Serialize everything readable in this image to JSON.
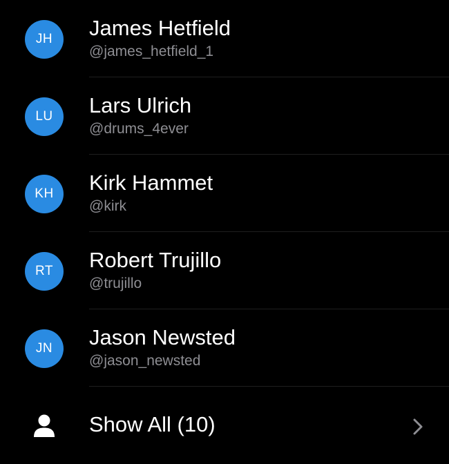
{
  "contacts": [
    {
      "initials": "JH",
      "name": "James Hetfield",
      "handle": "@james_hetfield_1"
    },
    {
      "initials": "LU",
      "name": "Lars Ulrich",
      "handle": "@drums_4ever"
    },
    {
      "initials": "KH",
      "name": "Kirk Hammet",
      "handle": "@kirk"
    },
    {
      "initials": "RT",
      "name": "Robert Trujillo",
      "handle": "@trujillo"
    },
    {
      "initials": "JN",
      "name": "Jason Newsted",
      "handle": "@jason_newsted"
    }
  ],
  "show_all": {
    "label": "Show All (10)",
    "icon": "person-icon",
    "chevron_icon": "chevron-right-icon"
  },
  "colors": {
    "background": "#000000",
    "avatar": "#2a8be2",
    "name_text": "#ffffff",
    "handle_text": "#8e8e93",
    "divider": "#1f1f1f",
    "chevron": "#8e8e93"
  }
}
